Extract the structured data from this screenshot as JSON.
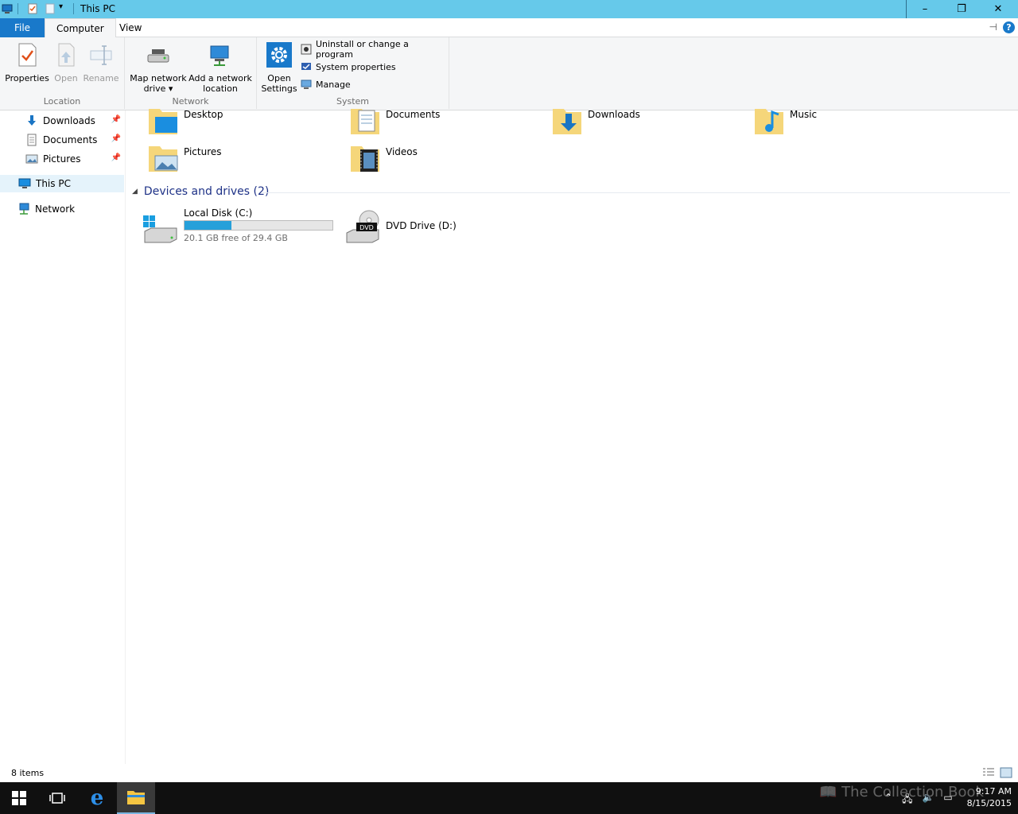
{
  "window": {
    "title": "This PC",
    "controls": {
      "minimize": "–",
      "restore": "❐",
      "close": "✕"
    }
  },
  "ribbon": {
    "tabs": [
      {
        "label": "File"
      },
      {
        "label": "Computer"
      },
      {
        "label": "View"
      }
    ],
    "help": "?",
    "groups": {
      "location": {
        "label": "Location",
        "buttons": [
          {
            "label": "Properties",
            "icon": "properties-icon"
          },
          {
            "label": "Open",
            "icon": "open-icon"
          },
          {
            "label": "Rename",
            "icon": "rename-icon"
          }
        ]
      },
      "network": {
        "label": "Network",
        "buttons": [
          {
            "label_line1": "Map network",
            "label_line2": "drive ▾",
            "icon": "map-network-drive-icon"
          },
          {
            "label_line1": "Add a network",
            "label_line2": "location",
            "icon": "add-network-location-icon"
          }
        ]
      },
      "system": {
        "label": "System",
        "open_settings_line1": "Open",
        "open_settings_line2": "Settings",
        "small_buttons": [
          {
            "label": "Uninstall or change a program",
            "icon": "uninstall-icon"
          },
          {
            "label": "System properties",
            "icon": "system-properties-icon"
          },
          {
            "label": "Manage",
            "icon": "manage-icon"
          }
        ]
      }
    }
  },
  "nav": {
    "quick_access": [
      {
        "label": "Downloads",
        "icon": "downloads-icon",
        "pinned": true
      },
      {
        "label": "Documents",
        "icon": "documents-icon",
        "pinned": true
      },
      {
        "label": "Pictures",
        "icon": "pictures-icon",
        "pinned": true
      }
    ],
    "this_pc": "This PC",
    "network": "Network"
  },
  "content": {
    "folders": [
      {
        "label": "Desktop",
        "icon": "desktop-folder-icon"
      },
      {
        "label": "Documents",
        "icon": "documents-folder-icon"
      },
      {
        "label": "Downloads",
        "icon": "downloads-folder-icon"
      },
      {
        "label": "Music",
        "icon": "music-folder-icon"
      },
      {
        "label": "Pictures",
        "icon": "pictures-folder-icon"
      },
      {
        "label": "Videos",
        "icon": "videos-folder-icon"
      }
    ],
    "devices_header": "Devices and drives (2)",
    "drives": [
      {
        "name": "Local Disk (C:)",
        "free_text": "20.1 GB free of 29.4 GB",
        "used_fraction": 0.316
      },
      {
        "name": "DVD Drive (D:)",
        "badge": "DVD"
      }
    ]
  },
  "status": {
    "items": "8 items"
  },
  "taskbar": {
    "time": "9:17 AM",
    "date": "8/15/2015",
    "watermark": "The Collection Book"
  },
  "colors": {
    "titlebar": "#66c9ea",
    "file_tab": "#1979ca",
    "accent": "#26a0da",
    "group_header": "#1e3287"
  }
}
